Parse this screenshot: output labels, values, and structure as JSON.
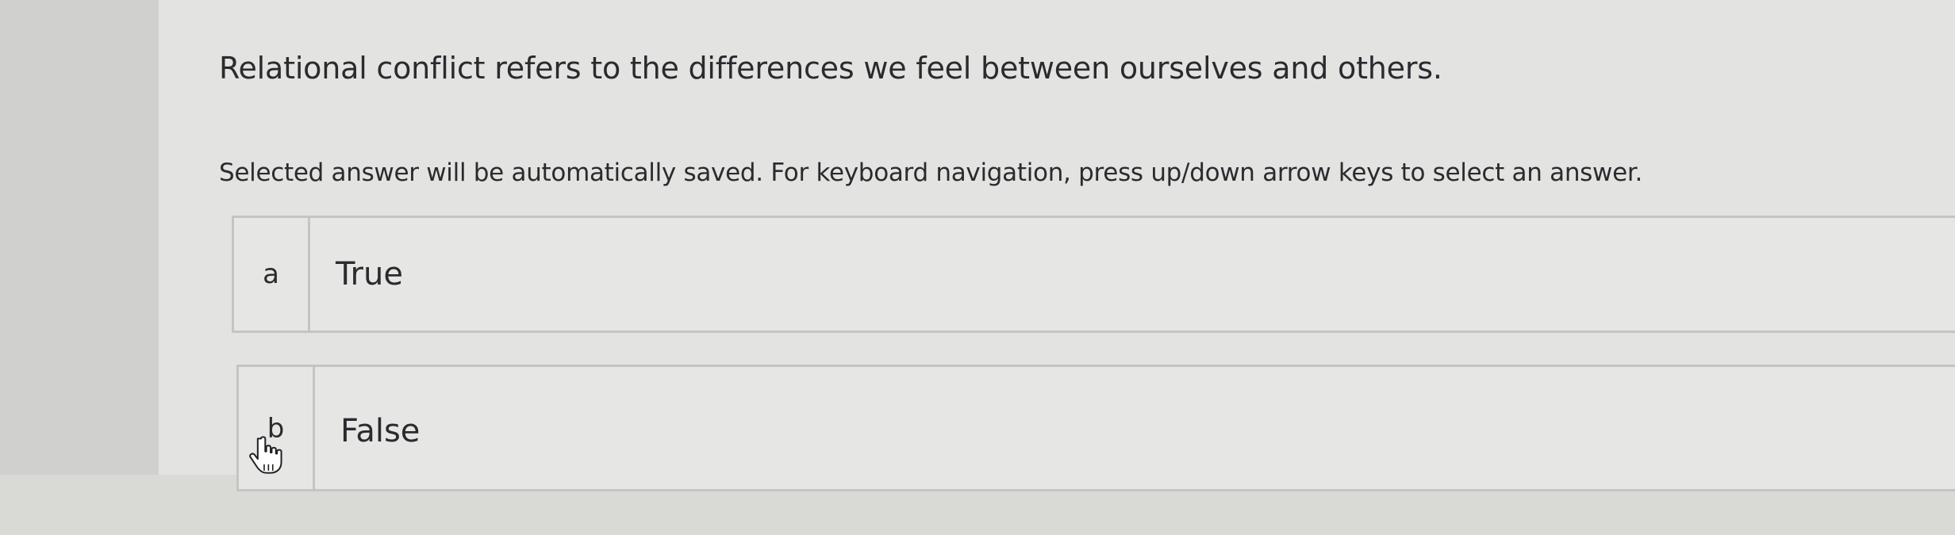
{
  "question": {
    "text": "Relational conflict refers to the differences we feel between ourselves and others."
  },
  "instructions": {
    "text": "Selected answer will be automatically saved. For keyboard navigation, press up/down arrow keys to select an answer."
  },
  "options": [
    {
      "letter": "a",
      "label": "True"
    },
    {
      "letter": "b",
      "label": "False"
    }
  ],
  "cursor": {
    "icon": "hand-pointer-icon"
  }
}
